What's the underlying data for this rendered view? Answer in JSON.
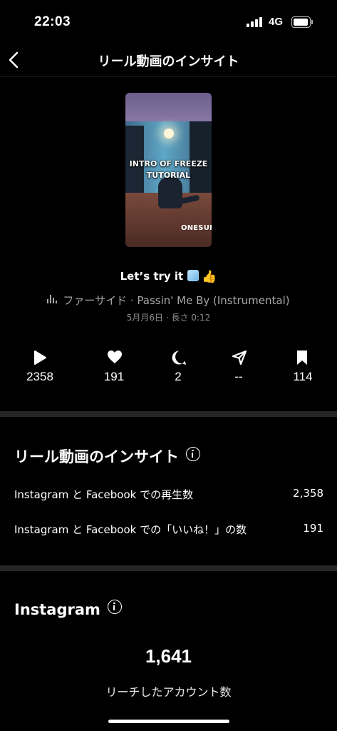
{
  "status_bar": {
    "time": "22:03",
    "network": "4G",
    "battery_level": 0.8
  },
  "header": {
    "title": "リール動画のインサイト",
    "back_icon": "chevron-left-icon"
  },
  "thumbnail": {
    "title_line1": "INTRO OF FREEZE",
    "title_line2": "TUTORIAL",
    "brand": "ONESUP"
  },
  "post": {
    "caption": "Let’s try it",
    "song": "ファーサイド · Passin' Me By (Instrumental)",
    "meta": "5月月6日 · 長さ 0:12"
  },
  "stats": [
    {
      "icon": "play-icon",
      "value": "2358"
    },
    {
      "icon": "heart-icon",
      "value": "191"
    },
    {
      "icon": "comment-icon",
      "value": "2"
    },
    {
      "icon": "share-icon",
      "value": "--"
    },
    {
      "icon": "bookmark-icon",
      "value": "114"
    }
  ],
  "reel_insights": {
    "title": "リール動画のインサイト",
    "rows": [
      {
        "label": "Instagram と Facebook での再生数",
        "value": "2,358"
      },
      {
        "label": "Instagram と Facebook での「いいね！」の数",
        "value": "191"
      }
    ]
  },
  "instagram": {
    "title": "Instagram",
    "reach_value": "1,641",
    "reach_label": "リーチしたアカウント数"
  }
}
